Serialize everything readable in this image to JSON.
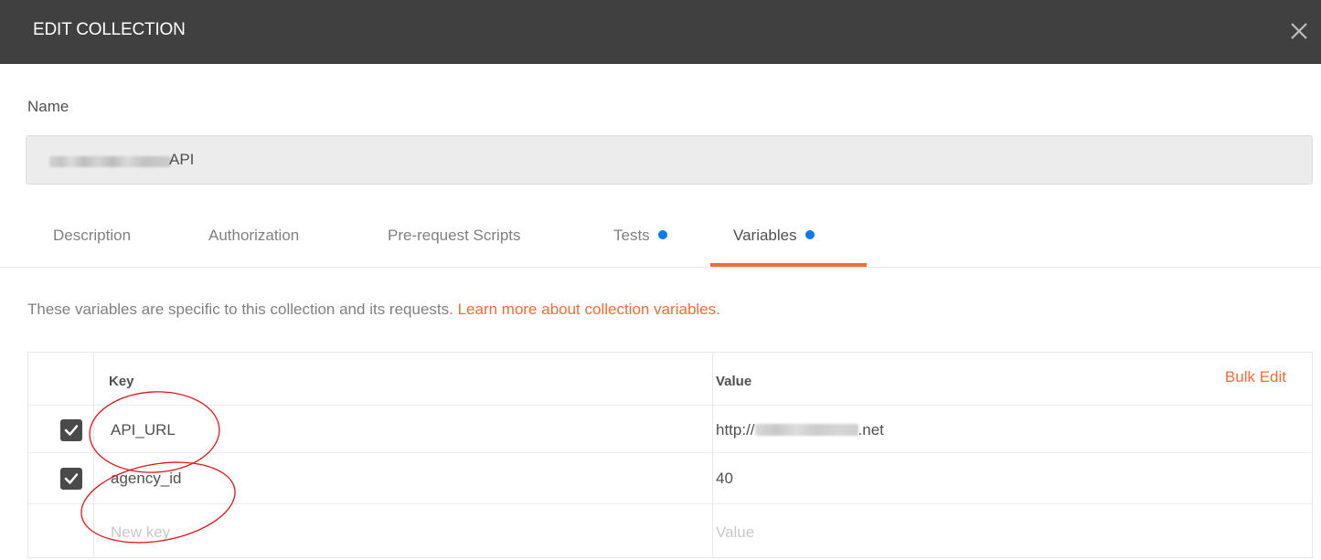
{
  "dialog": {
    "title": "EDIT COLLECTION",
    "close_glyph": "✕"
  },
  "name_field": {
    "label": "Name",
    "value_suffix": "API"
  },
  "tabs": [
    {
      "label": "Description",
      "active": false,
      "dot": false
    },
    {
      "label": "Authorization",
      "active": false,
      "dot": false
    },
    {
      "label": "Pre-request Scripts",
      "active": false,
      "dot": false
    },
    {
      "label": "Tests",
      "active": false,
      "dot": true
    },
    {
      "label": "Variables",
      "active": true,
      "dot": true
    }
  ],
  "info": {
    "text": "These variables are specific to this collection and its requests. ",
    "link": "Learn more about collection variables."
  },
  "table": {
    "headers": {
      "key": "Key",
      "value": "Value"
    },
    "bulk_edit": "Bulk Edit",
    "rows": [
      {
        "key": "API_URL",
        "value_prefix": "http://",
        "value_suffix": ".net",
        "checked": true
      },
      {
        "key": "agency_id",
        "value": "40",
        "checked": true
      }
    ],
    "new_row": {
      "key_placeholder": "New key",
      "value_placeholder": "Value"
    }
  },
  "colors": {
    "accent": "#f26b3a",
    "dot": "#097bed",
    "titlebar": "#404040",
    "annotation": "#e0141c"
  },
  "icons": [
    "close-icon",
    "checkbox-checked-icon"
  ]
}
